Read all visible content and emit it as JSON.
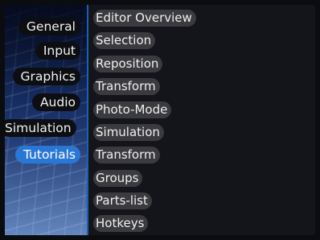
{
  "sidebar": {
    "items": [
      {
        "label": "General",
        "active": false
      },
      {
        "label": "Input",
        "active": false
      },
      {
        "label": "Graphics",
        "active": false
      },
      {
        "label": "Audio",
        "active": false
      },
      {
        "label": "Simulation",
        "active": false
      },
      {
        "label": "Tutorials",
        "active": true
      }
    ]
  },
  "tutorials": {
    "items": [
      "Editor Overview",
      "Selection",
      "Reposition",
      "Transform",
      "Photo-Mode",
      "Simulation",
      "Transform",
      "Groups",
      "Parts-list",
      "Hotkeys"
    ]
  },
  "colors": {
    "active": "#2a78d6",
    "item_bg": "#3a3a3f",
    "panel_bg": "#14151a"
  }
}
